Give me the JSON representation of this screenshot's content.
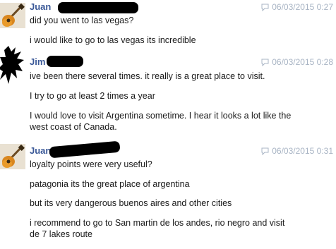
{
  "messages": [
    {
      "author": "Juan",
      "timestamp": "06/03/2015 0:27",
      "lines": [
        "did you went to las vegas?",
        "i would like to go to las vegas its incredible"
      ]
    },
    {
      "author": "Jim",
      "timestamp": "06/03/2015 0:28",
      "lines": [
        "ive been there several times. it really is a great place to visit.",
        "I try to go at least 2 times a year",
        "I would love to visit Argentina sometime. I hear it looks a lot like the west coast of Canada."
      ]
    },
    {
      "author": "Juan",
      "timestamp": "06/03/2015 0:31",
      "lines": [
        "loyalty points were very useful?",
        "patagonia its the great place of argentina",
        "but its very dangerous buenos aires and other cities",
        "i recommend to go to San martin de los andes, rio negro and visit de 7 lakes route"
      ]
    }
  ],
  "icons": {
    "comment": "speech-bubble-icon",
    "avatar_juan": "guitar-icon",
    "avatar_jim": "silhouette-icon"
  }
}
